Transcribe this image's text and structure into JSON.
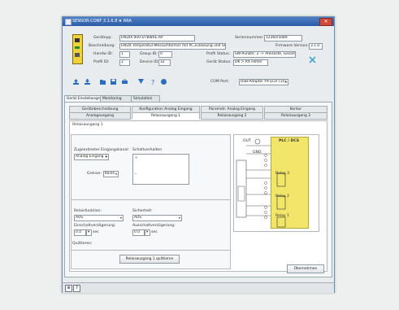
{
  "window": {
    "title": "SENSOR-CONF 3.1.6.8 ❦ RRA"
  },
  "device_info": {
    "bestellnr_label": "Geräteyp:",
    "bestellnr_value": "FAIDIX 000-DT8WXE.AP",
    "serial_label": "Seriennummer:",
    "serial_value": "12360/5089",
    "beschreibung_label": "Beschreibung:",
    "beschreibung_value": "FAIDX Temperatur-Messumformer mit PL Zulassung und SI",
    "firmware_label": "Firmware Version:",
    "firmware_value": "3.1.0",
    "handw_label": "Handw ID:",
    "handw_value": "1",
    "group_label": "Group ID:",
    "group_value": "0",
    "profil_label": "Profil Status:",
    "profil_value": "SW-Punkte: 2 -> Preisliste, Gesamtgerät",
    "pcb_label": "Profil ID:",
    "pcb_value": "2",
    "device_label": "Device ID:",
    "device_value": "32",
    "geraet_label": "Gerät Status:",
    "geraet_value": "OK > RX Fehler",
    "comm_label": "COM Port:",
    "comm_value": "USB-Adapter PX-ECH (10)"
  },
  "toolbar": {
    "icons": [
      "upload-device-icon",
      "download-device-icon",
      "open-file-icon",
      "save-file-icon",
      "print-icon",
      "settings-icon",
      "help-icon",
      "info-icon"
    ]
  },
  "main_tabs": [
    {
      "label": "Gerät Einstellungen"
    },
    {
      "label": "Monitoring"
    },
    {
      "label": "Simulation"
    }
  ],
  "sub_tabs_row1": [
    {
      "label": "Gerätebeschreibung"
    },
    {
      "label": "Konfiguration Analog Eingang"
    },
    {
      "label": "Parametr. Analog Eingang"
    },
    {
      "label": "Kontur"
    }
  ],
  "sub_tabs_row2": [
    {
      "label": "Analogausgang"
    },
    {
      "label": "Relaisausgang 1"
    },
    {
      "label": "Relaisausgang 2"
    },
    {
      "label": "Relaisausgang 3"
    }
  ],
  "relay_panel": {
    "title": "Relaisausgang 1",
    "input_label": "Zugeordneter Eingangskanal:",
    "input_value": "Analog Eingang 1",
    "limit_label": "Schaltverhalten",
    "limit_top": "+",
    "limit_bottom": "–",
    "mode_label": "Grenze:",
    "mode_value": "Keine",
    "funktion_label": "Relaisfunktion:",
    "funktion_value": "AUS",
    "schalt_label": "Sicherheit:",
    "schalt_value": "AUS",
    "einschalt_label": "Einschaltverzögerung:",
    "einschalt_value": "0.0",
    "einschalt_unit": "sec",
    "ausschalt_label": "Ausschaltverzögerung:",
    "ausschalt_value": "0.0",
    "ausschalt_unit": "sec",
    "quittieren_label": "Quittieren:",
    "quittieren_button": "Relaisausgang 1 quittieren"
  },
  "schematic": {
    "out_label": "OUT",
    "plc_label": "PLC / DCS",
    "gnd_label": "GND",
    "relay3": "Relay 3",
    "relay2": "Relay 2",
    "relay1": "Relay 1"
  },
  "buttons": {
    "apply": "Übernehmen"
  },
  "colors": {
    "accent": "#2a5ca6",
    "plc": "#f2e66a",
    "device": "#f0d23a"
  }
}
